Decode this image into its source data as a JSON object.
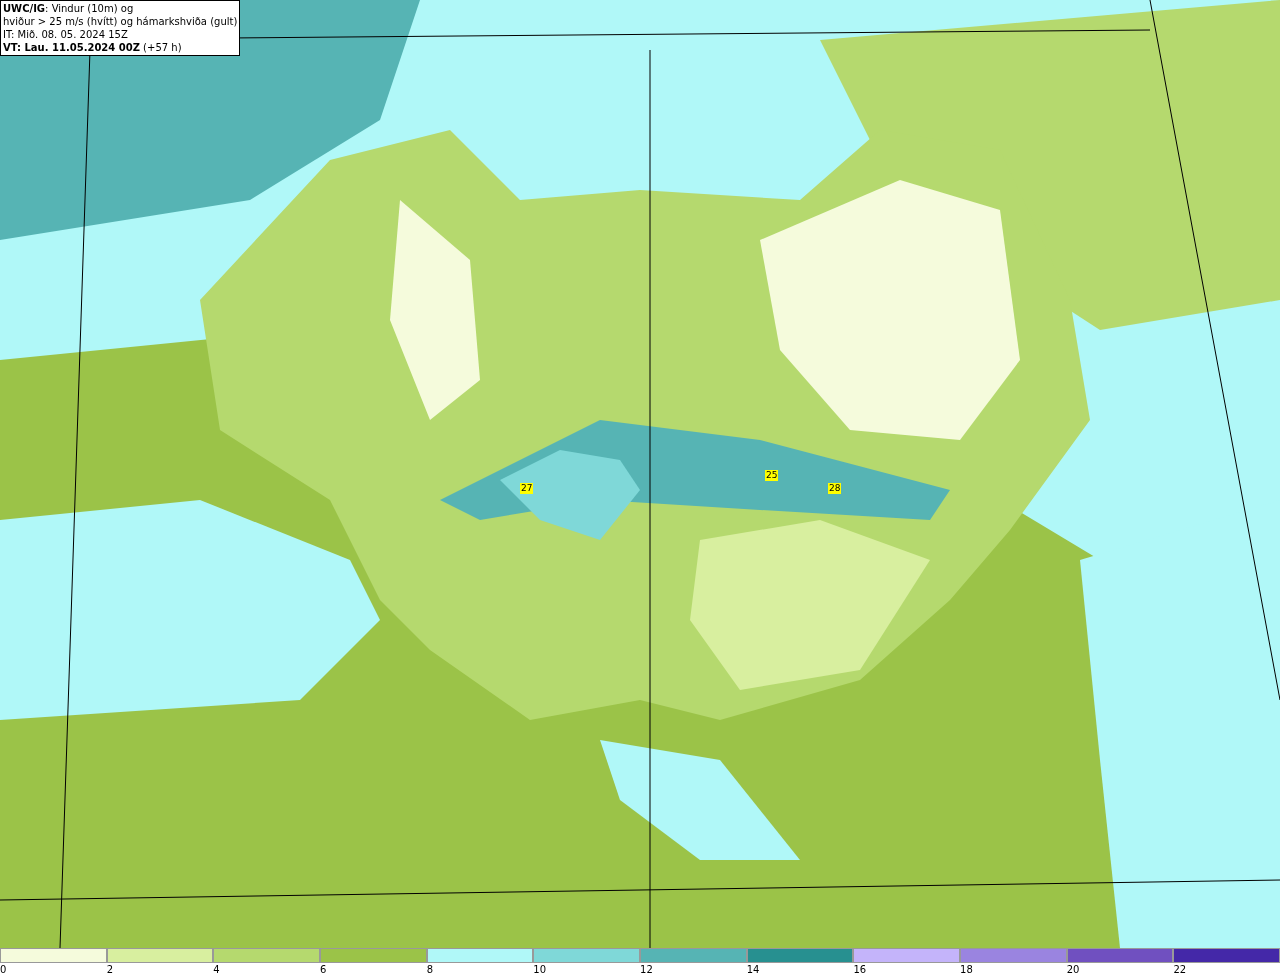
{
  "info_box": {
    "lines": [
      "**UWC/IG**: Vindur (10m) og",
      "hviður > 25 m/s (hvítt) og hámarkshviða (gult)",
      "IT: Mið. 08. 05. 2024 15Z",
      "**VT: Lau. 11.05.2024 00Z** (+57 h)"
    ]
  },
  "map": {
    "gust_labels": [
      "27",
      "25",
      "28"
    ]
  },
  "color_scale": [
    {
      "label": "0",
      "color": "#f5fbdc"
    },
    {
      "label": "2",
      "color": "#d8ef9f"
    },
    {
      "label": "4",
      "color": "#b5d96e"
    },
    {
      "label": "6",
      "color": "#9bc348"
    },
    {
      "label": "8",
      "color": "#b0f8f8"
    },
    {
      "label": "10",
      "color": "#7fd8d8"
    },
    {
      "label": "12",
      "color": "#56b4b4"
    },
    {
      "label": "14",
      "color": "#279090"
    },
    {
      "label": "16",
      "color": "#c4b4fa"
    },
    {
      "label": "18",
      "color": "#9a84e0"
    },
    {
      "label": "20",
      "color": "#7050c0"
    },
    {
      "label": "22",
      "color": "#4428a8"
    }
  ]
}
